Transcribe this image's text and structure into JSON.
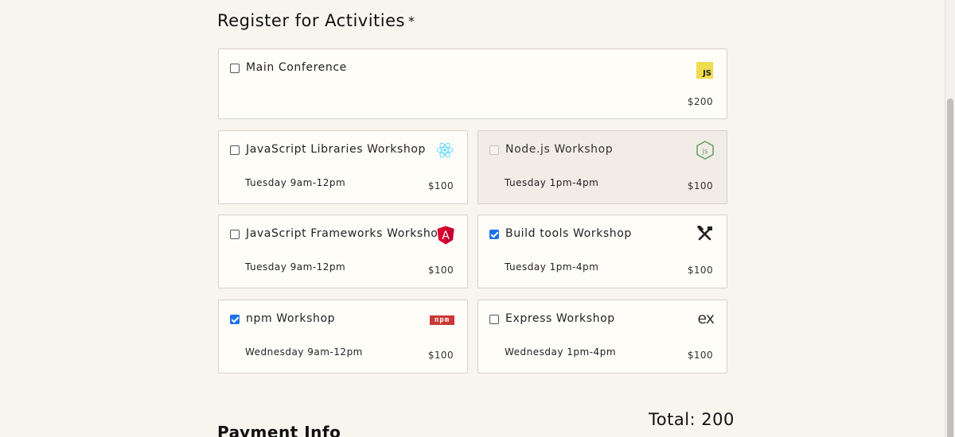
{
  "heading": {
    "title": "Register for Activities",
    "required_mark": "*"
  },
  "activities": [
    {
      "id": "main",
      "title": "Main Conference",
      "time": "",
      "price": "$200",
      "icon": "js-logo-icon",
      "checked": false,
      "disabled": false
    },
    {
      "id": "js-libs",
      "title": "JavaScript Libraries Workshop",
      "time": "Tuesday 9am-12pm",
      "price": "$100",
      "icon": "react-logo-icon",
      "checked": false,
      "disabled": false
    },
    {
      "id": "node",
      "title": "Node.js Workshop",
      "time": "Tuesday 1pm-4pm",
      "price": "$100",
      "icon": "nodejs-logo-icon",
      "checked": false,
      "disabled": true
    },
    {
      "id": "js-frameworks",
      "title": "JavaScript Frameworks Workshop",
      "time": "Tuesday 9am-12pm",
      "price": "$100",
      "icon": "angular-logo-icon",
      "checked": false,
      "disabled": false
    },
    {
      "id": "build-tools",
      "title": "Build tools Workshop",
      "time": "Tuesday 1pm-4pm",
      "price": "$100",
      "icon": "tools-icon",
      "checked": true,
      "disabled": false
    },
    {
      "id": "npm",
      "title": "npm Workshop",
      "time": "Wednesday 9am-12pm",
      "price": "$100",
      "icon": "npm-logo-icon",
      "checked": true,
      "disabled": false
    },
    {
      "id": "express",
      "title": "Express Workshop",
      "time": "Wednesday 1pm-4pm",
      "price": "$100",
      "icon": "express-logo-icon",
      "checked": false,
      "disabled": false
    }
  ],
  "logos": {
    "js": "JS",
    "npm": "npm",
    "express": "ex",
    "angular": "A"
  },
  "total": {
    "label": "Total: 200"
  },
  "payment": {
    "title": "Payment Info"
  },
  "colors": {
    "checkbox_checked": "#1a73e8",
    "js_yellow": "#f0db4f",
    "npm_red": "#cb3837",
    "angular_red": "#dd0031",
    "react_blue": "#61dafb",
    "node_green": "#68a063"
  }
}
